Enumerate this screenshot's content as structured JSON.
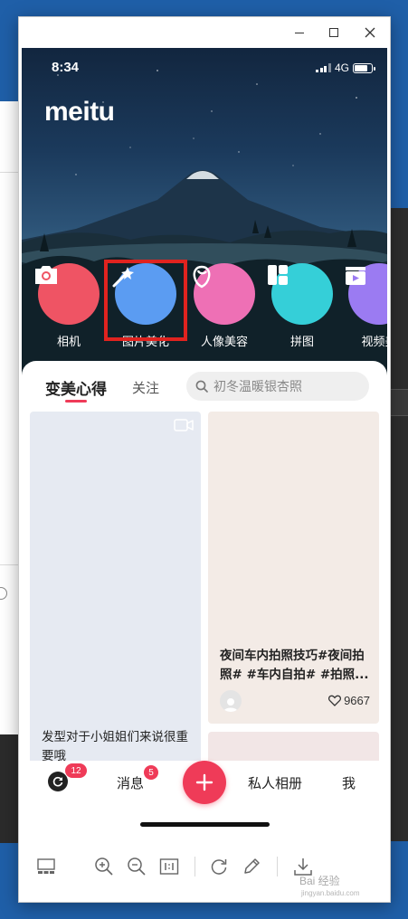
{
  "status_bar": {
    "time": "8:34",
    "network": "4G"
  },
  "app": {
    "logo": "meitu"
  },
  "features": [
    {
      "label": "相机",
      "icon": "camera-icon",
      "color": "#ef5464"
    },
    {
      "label": "图片美化",
      "icon": "magic-wand-icon",
      "color": "#5b9cf2"
    },
    {
      "label": "人像美容",
      "icon": "face-outline-icon",
      "color": "#ee70b5"
    },
    {
      "label": "拼图",
      "icon": "grid-layout-icon",
      "color": "#35cfd8"
    },
    {
      "label": "视频美",
      "icon": "clapperboard-icon",
      "color": "#9b7bf2"
    }
  ],
  "feed": {
    "tabs": [
      {
        "label": "变美心得",
        "active": true
      },
      {
        "label": "关注",
        "active": false
      }
    ],
    "search_placeholder": "初冬温暖银杏照",
    "cards": [
      {
        "title": "发型对于小姐姐们来说很重要哦",
        "type": "video"
      },
      {
        "title": "夜间车内拍照技巧#夜间拍照# #车内自拍# #拍照...",
        "likes": "9667"
      }
    ]
  },
  "bottom_nav": {
    "refresh_badge": "12",
    "messages_label": "消息",
    "messages_badge": "5",
    "album_label": "私人相册",
    "me_label": "我"
  },
  "watermark": {
    "text": "Bai 经验",
    "sub": "jingyan.baidu.com"
  },
  "colors": {
    "accent": "#ef3b58",
    "highlight_box": "#e0231f"
  }
}
